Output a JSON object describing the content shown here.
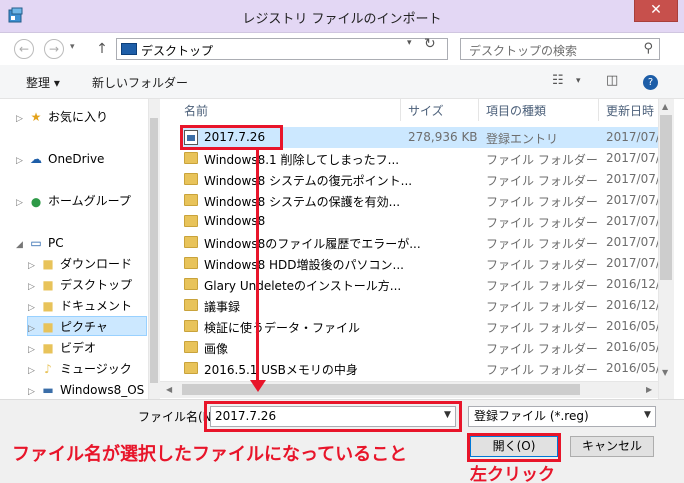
{
  "window": {
    "title": "レジストリ ファイルのインポート",
    "close_glyph": "✕"
  },
  "nav": {
    "back_glyph": "←",
    "forward_glyph": "→",
    "up_glyph": "↑",
    "address": "デスクトップ",
    "search_placeholder": "デスクトップの検索"
  },
  "toolbar": {
    "organize": "整理 ▾",
    "new_folder": "新しいフォルダー"
  },
  "tree": [
    {
      "label": "お気に入り",
      "icon": "star-icon",
      "glyph": "★",
      "color": "#e3a21a"
    },
    {
      "label": "OneDrive",
      "icon": "cloud-icon",
      "glyph": "☁",
      "color": "#1e5ea8"
    },
    {
      "label": "ホームグループ",
      "icon": "homegroup-icon",
      "glyph": "⬤",
      "color": "#2e9a47"
    },
    {
      "label": "PC",
      "icon": "computer-icon",
      "glyph": "▭",
      "color": "#1e5ea8"
    },
    {
      "label": "ダウンロード",
      "icon": "download-folder-icon",
      "glyph": "■",
      "color": "#e8c35a"
    },
    {
      "label": "デスクトップ",
      "icon": "desktop-folder-icon",
      "glyph": "■",
      "color": "#e8c35a"
    },
    {
      "label": "ドキュメント",
      "icon": "documents-folder-icon",
      "glyph": "■",
      "color": "#e8c35a"
    },
    {
      "label": "ピクチャ",
      "icon": "pictures-folder-icon",
      "glyph": "■",
      "color": "#e8c35a"
    },
    {
      "label": "ビデオ",
      "icon": "videos-folder-icon",
      "glyph": "■",
      "color": "#e8c35a"
    },
    {
      "label": "ミュージック",
      "icon": "music-folder-icon",
      "glyph": "♪",
      "color": "#e8c35a"
    },
    {
      "label": "Windows8_OS (",
      "icon": "drive-icon",
      "glyph": "▬",
      "color": "#3b6ea8"
    }
  ],
  "columns": {
    "name": "名前",
    "size": "サイズ",
    "type": "項目の種類",
    "date": "更新日時"
  },
  "files": [
    {
      "name": "2017.7.26",
      "size": "278,936 KB",
      "type": "登録エントリ",
      "date": "2017/07/"
    },
    {
      "name": "Windows8.1 削除してしまったフ...",
      "size": "",
      "type": "ファイル フォルダー",
      "date": "2017/07/"
    },
    {
      "name": "Windows8 システムの復元ポイント...",
      "size": "",
      "type": "ファイル フォルダー",
      "date": "2017/07/"
    },
    {
      "name": "Windows8 システムの保護を有効...",
      "size": "",
      "type": "ファイル フォルダー",
      "date": "2017/07/"
    },
    {
      "name": "Windows8",
      "size": "",
      "type": "ファイル フォルダー",
      "date": "2017/07/"
    },
    {
      "name": "Windows8のファイル履歴でエラーが...",
      "size": "",
      "type": "ファイル フォルダー",
      "date": "2017/07/"
    },
    {
      "name": "Windows8 HDD増設後のパソコン...",
      "size": "",
      "type": "ファイル フォルダー",
      "date": "2017/07/"
    },
    {
      "name": "Glary Undeleteのインストール方...",
      "size": "",
      "type": "ファイル フォルダー",
      "date": "2016/12/"
    },
    {
      "name": "議事録",
      "size": "",
      "type": "ファイル フォルダー",
      "date": "2016/12/"
    },
    {
      "name": "検証に使うデータ・ファイル",
      "size": "",
      "type": "ファイル フォルダー",
      "date": "2016/05/"
    },
    {
      "name": "画像",
      "size": "",
      "type": "ファイル フォルダー",
      "date": "2016/05/"
    },
    {
      "name": "2016.5.1 USBメモリの中身",
      "size": "",
      "type": "ファイル フォルダー",
      "date": "2016/05/"
    }
  ],
  "bottom": {
    "filename_label": "ファイル名(N):",
    "filename_value": "2017.7.26",
    "filetype": "登録ファイル (*.reg)",
    "open": "開く(O)",
    "cancel": "キャンセル"
  },
  "annotations": {
    "filename_note": "ファイル名が選択したファイルになっていること",
    "click_note": "左クリック",
    "color": "#e8152a"
  }
}
